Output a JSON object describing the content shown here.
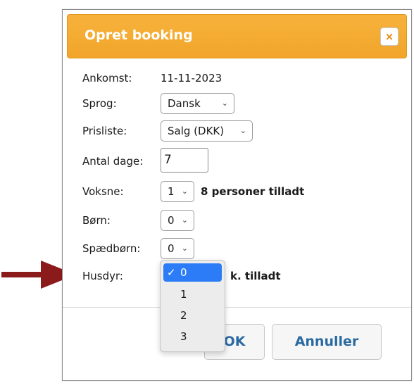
{
  "dialog": {
    "title": "Opret booking",
    "close_glyph": "×"
  },
  "form": {
    "arrival_label": "Ankomst:",
    "arrival_value": "11-11-2023",
    "language_label": "Sprog:",
    "language_value": "Dansk",
    "pricelist_label": "Prisliste:",
    "pricelist_value": "Salg (DKK)",
    "days_label": "Antal dage:",
    "days_value": "7",
    "adults_label": "Voksne:",
    "adults_value": "1",
    "adults_note": "8 personer tilladt",
    "children_label": "Børn:",
    "children_value": "0",
    "infants_label": "Spædbørn:",
    "infants_value": "0",
    "pets_label": "Husdyr:",
    "pets_note": "k. tilladt"
  },
  "dropdown": {
    "check": "✓",
    "options": [
      "0",
      "1",
      "2",
      "3"
    ],
    "selected_index": 0
  },
  "buttons": {
    "ok_label": "OK",
    "cancel_label": "Annuller"
  },
  "colors": {
    "header": "#f1a52a",
    "button_text": "#2a6aa3",
    "arrow": "#8b1a1a",
    "selection": "#2b7cf6"
  },
  "icons": {
    "close": "close-icon",
    "select": "chevron-down-icon",
    "checkmark": "checkmark-icon",
    "annotation": "arrow-icon"
  }
}
